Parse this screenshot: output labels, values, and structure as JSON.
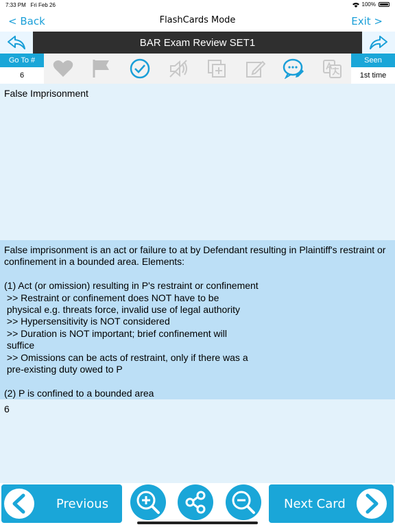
{
  "status": {
    "time": "7:33 PM",
    "date": "Fri Feb 26",
    "battery": "100%"
  },
  "nav": {
    "back": "< Back",
    "title": "FlashCards Mode",
    "exit": "Exit >"
  },
  "deck": {
    "title": "BAR Exam Review SET1"
  },
  "goto": {
    "label": "Go To #",
    "value": "6"
  },
  "seen": {
    "label": "Seen",
    "value": "1st time"
  },
  "toolbar_icons": [
    "heart-icon",
    "flag-icon",
    "check-icon",
    "mute-speaker-icon",
    "duplicate-icon",
    "edit-icon",
    "comment-icon",
    "translate-icon"
  ],
  "card": {
    "question": "False Imprisonment",
    "answer": "False imprisonment is an act or failure to at by Defendant resulting in Plaintiff's restraint or confinement in a bounded area. Elements:\n\n(1) Act (or omission) resulting in P's restraint or confinement\n >> Restraint or confinement does NOT have to be\n physical e.g. threats force, invalid use of legal authority\n >> Hypersensitivity is NOT considered\n >> Duration is NOT important; brief confinement will\n suffice\n >> Omissions can be acts of restraint, only if there was a\n pre-existing duty owed to P\n\n(2) P is confined to a bounded area",
    "number": "6"
  },
  "bottom": {
    "previous": "Previous",
    "next": "Next Card"
  },
  "colors": {
    "accent": "#1aa6d8",
    "question_bg": "#e3f2fb",
    "answer_bg": "#bcdff6",
    "titlebar_bg": "#2f2f2f"
  }
}
